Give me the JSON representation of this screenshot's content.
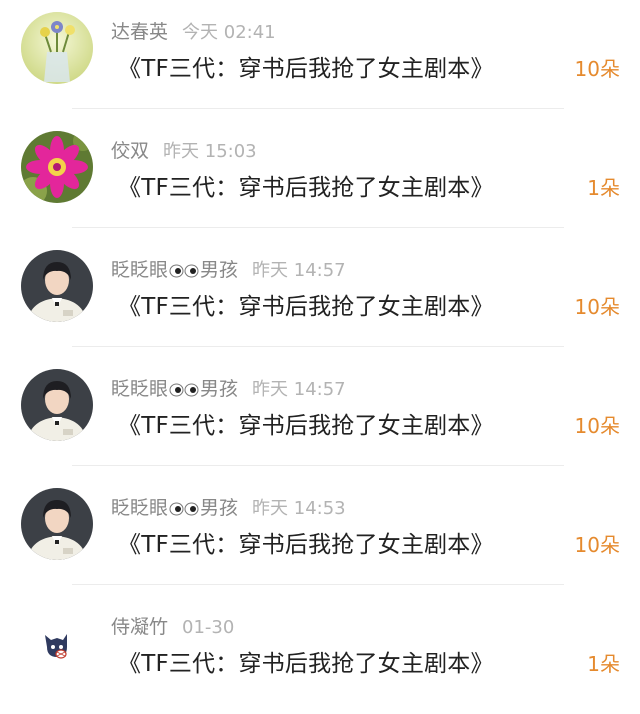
{
  "messages": [
    {
      "avatar_icon": "flower-vase-photo-avatar",
      "name": "达春英",
      "time": "今天 02:41",
      "title": "《TF三代：穿书后我抢了女主剧本》",
      "count": "10朵"
    },
    {
      "avatar_icon": "pink-cactus-flower-avatar",
      "name": "佼双",
      "time": "昨天 15:03",
      "title": "《TF三代：穿书后我抢了女主剧本》",
      "count": "1朵"
    },
    {
      "avatar_icon": "boy-portrait-avatar",
      "name_prefix": "眨眨眼",
      "name_suffix": "男孩",
      "name_emoji": "eyes-emoji",
      "time": "昨天 14:57",
      "title": "《TF三代：穿书后我抢了女主剧本》",
      "count": "10朵"
    },
    {
      "avatar_icon": "boy-portrait-avatar",
      "name_prefix": "眨眨眼",
      "name_suffix": "男孩",
      "name_emoji": "eyes-emoji",
      "time": "昨天 14:57",
      "title": "《TF三代：穿书后我抢了女主剧本》",
      "count": "10朵"
    },
    {
      "avatar_icon": "boy-portrait-avatar",
      "name_prefix": "眨眨眼",
      "name_suffix": "男孩",
      "name_emoji": "eyes-emoji",
      "time": "昨天 14:53",
      "title": "《TF三代：穿书后我抢了女主剧本》",
      "count": "10朵"
    },
    {
      "avatar_icon": "cartoon-cat-avatar",
      "name": "侍凝竹",
      "time": "01-30",
      "title": "《TF三代：穿书后我抢了女主剧本》",
      "count": "1朵"
    }
  ],
  "colors": {
    "count": "#e58a2e",
    "name": "#888888",
    "time": "#b3b3b3",
    "title": "#222222",
    "divider": "#ececec"
  }
}
